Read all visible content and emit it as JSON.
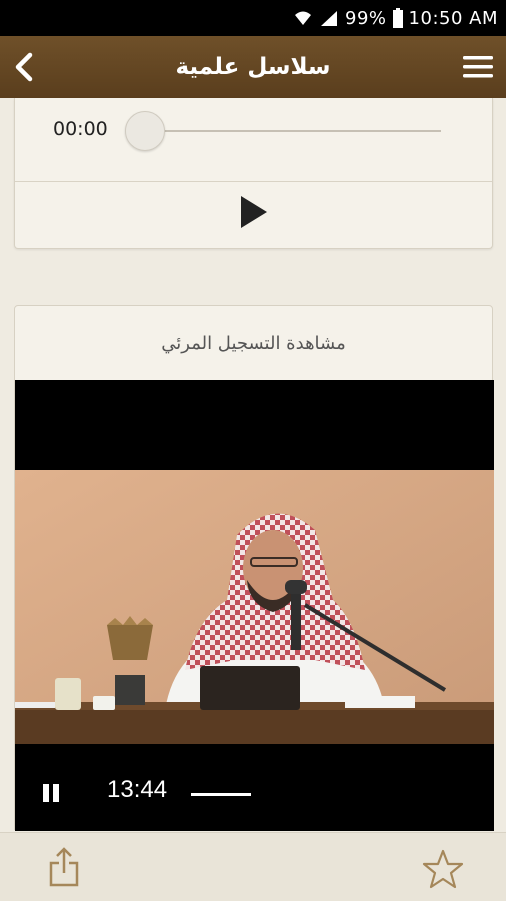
{
  "status_bar": {
    "battery_percent": "99%",
    "time": "10:50 AM",
    "icons": [
      "wifi-icon",
      "signal-icon",
      "battery-icon"
    ]
  },
  "app_bar": {
    "title": "سلاسل علمية",
    "icons": [
      "back-icon",
      "menu-icon"
    ],
    "color": "#654825"
  },
  "audio_player": {
    "current_time": "00:00",
    "progress": 0,
    "icons": [
      "play-icon"
    ]
  },
  "video_section": {
    "header": "مشاهدة التسجيل المرئي",
    "current_time": "13:44",
    "icons": [
      "pause-icon"
    ]
  },
  "bottom_bar": {
    "icons": [
      "share-icon",
      "star-icon"
    ]
  }
}
